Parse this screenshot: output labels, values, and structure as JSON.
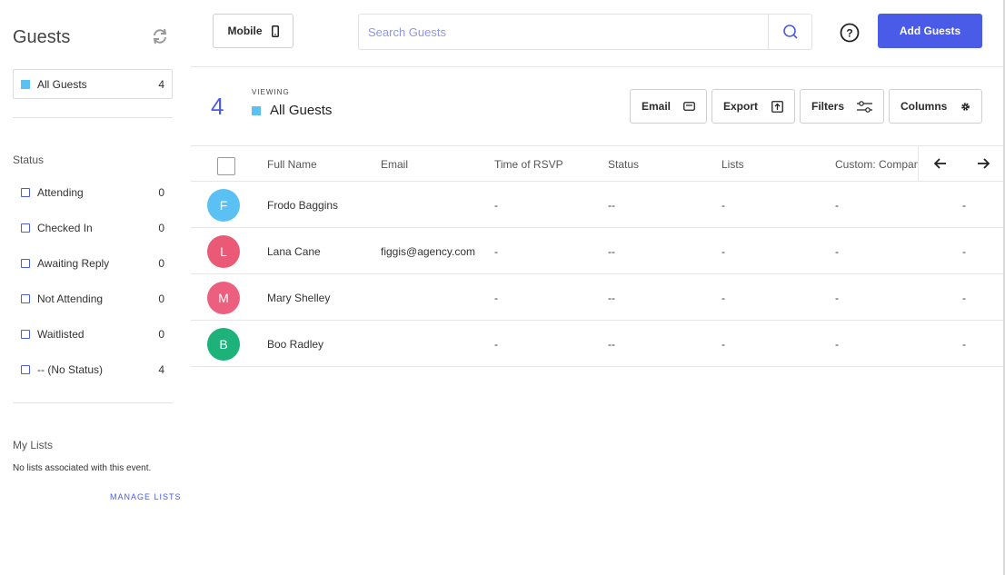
{
  "sidebar": {
    "title": "Guests",
    "all_guests": {
      "label": "All Guests",
      "count": "4",
      "color": "#5bc0f3"
    },
    "status_label": "Status",
    "statuses": [
      {
        "label": "Attending",
        "count": "0"
      },
      {
        "label": "Checked In",
        "count": "0"
      },
      {
        "label": "Awaiting Reply",
        "count": "0"
      },
      {
        "label": "Not Attending",
        "count": "0"
      },
      {
        "label": "Waitlisted",
        "count": "0"
      },
      {
        "label": "-- (No Status)",
        "count": "4"
      }
    ],
    "my_lists_label": "My Lists",
    "no_lists_text": "No lists associated with this event.",
    "manage_lists": "MANAGE LISTS"
  },
  "topbar": {
    "mobile_label": "Mobile",
    "search_placeholder": "Search Guests",
    "add_guests": "Add Guests"
  },
  "view": {
    "count": "4",
    "viewing_label": "VIEWING",
    "name": "All Guests"
  },
  "actions": {
    "email": "Email",
    "export": "Export",
    "filters": "Filters",
    "columns": "Columns"
  },
  "table": {
    "columns": [
      "Full Name",
      "Email",
      "Time of RSVP",
      "Status",
      "Lists",
      "Custom: Compan"
    ],
    "rows": [
      {
        "initial": "F",
        "avatar_color": "#5bc0f3",
        "name": "Frodo Baggins",
        "email": "",
        "rsvp": "-",
        "status": "--",
        "lists": "-",
        "custom": "-",
        "extra": "-"
      },
      {
        "initial": "L",
        "avatar_color": "#ea5a76",
        "name": "Lana Cane",
        "email": "figgis@agency.com",
        "rsvp": "-",
        "status": "--",
        "lists": "-",
        "custom": "-",
        "extra": "-"
      },
      {
        "initial": "M",
        "avatar_color": "#ec5f7f",
        "name": "Mary Shelley",
        "email": "",
        "rsvp": "-",
        "status": "--",
        "lists": "-",
        "custom": "-",
        "extra": "-"
      },
      {
        "initial": "B",
        "avatar_color": "#1db27a",
        "name": "Boo Radley",
        "email": "",
        "rsvp": "-",
        "status": "--",
        "lists": "-",
        "custom": "-",
        "extra": "-"
      }
    ]
  },
  "colors": {
    "accent": "#4a5be8",
    "list_color": "#5bc0f3"
  },
  "icons": [
    "refresh-icon",
    "mobile-phone-icon",
    "search-icon",
    "help-icon",
    "envelope-icon",
    "export-icon",
    "filters-icon",
    "gear-icon",
    "arrow-left-icon",
    "arrow-right-icon"
  ]
}
